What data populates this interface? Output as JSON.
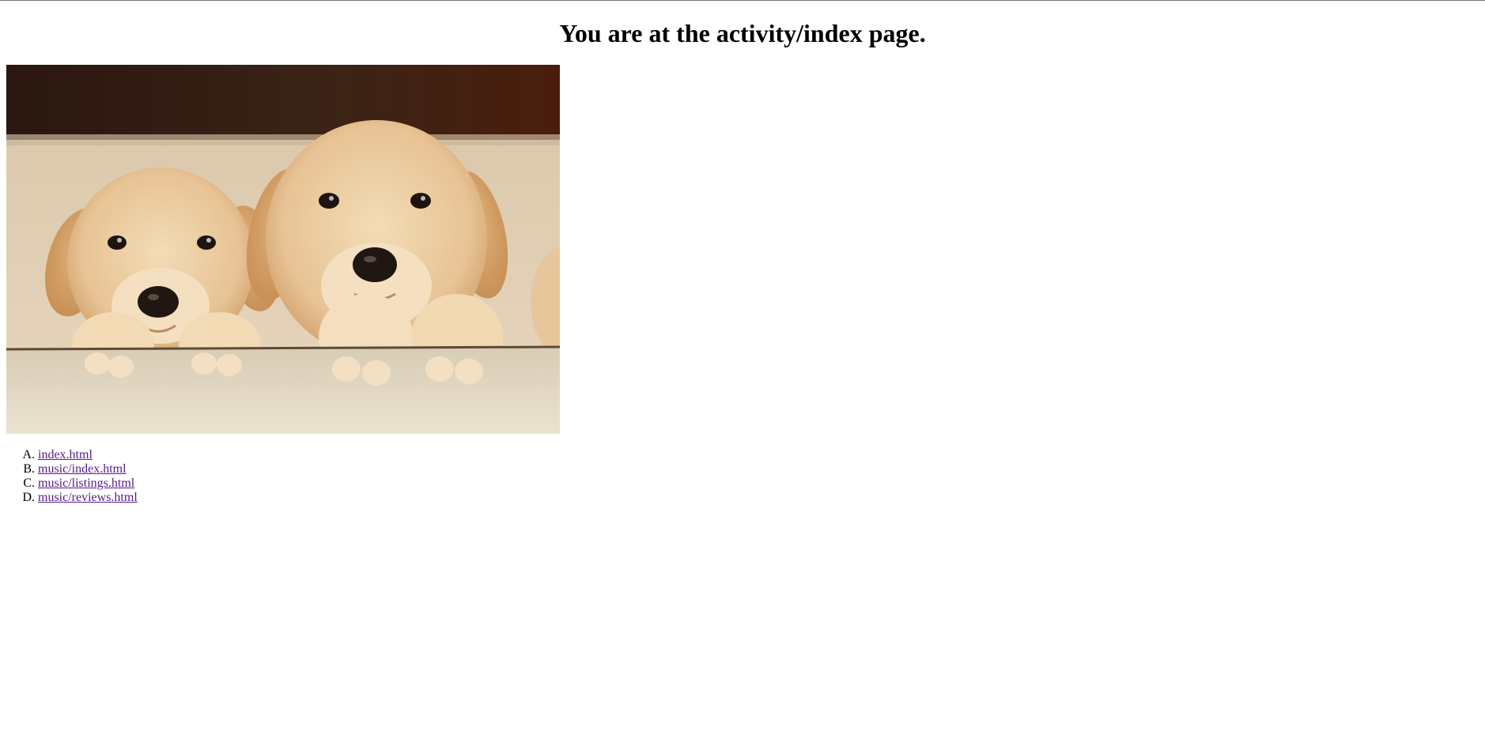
{
  "page": {
    "heading": "You are at the activity/index page."
  },
  "image": {
    "alt": "Two golden retriever puppies resting their paws on a ledge",
    "subject": "puppies-photo"
  },
  "links": [
    {
      "marker": "A.",
      "label": "index.html"
    },
    {
      "marker": "B.",
      "label": "music/index.html"
    },
    {
      "marker": "C.",
      "label": "music/listings.html"
    },
    {
      "marker": "D.",
      "label": "music/reviews.html"
    }
  ],
  "colors": {
    "visited_link": "#551a8b",
    "text": "#000000",
    "background": "#ffffff"
  }
}
